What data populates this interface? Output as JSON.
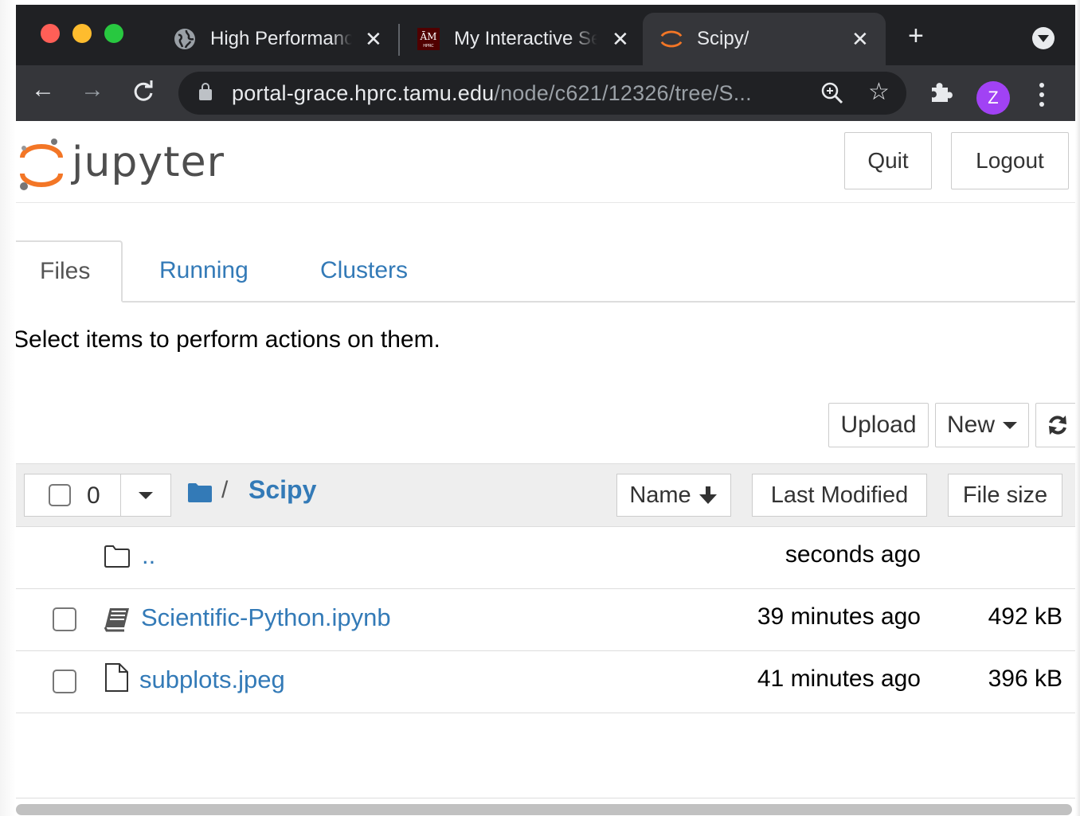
{
  "browser": {
    "tabs": [
      {
        "title": "High Performance Research Computing",
        "icon": "globe-icon"
      },
      {
        "title": "My Interactive Sessions",
        "icon": "tamu-hprc-icon"
      },
      {
        "title": "Scipy/",
        "icon": "jupyter-icon"
      }
    ],
    "active_tab": 2,
    "url_host": "portal-grace.hprc.tamu.edu",
    "url_path": "/node/c621/12326/tree/S...",
    "profile_initial": "Z",
    "colors": {
      "tab_strip": "#202124",
      "toolbar": "#35363a",
      "avatar": "#a142f4"
    }
  },
  "header": {
    "logo_text": "jupyter",
    "quit_label": "Quit",
    "logout_label": "Logout"
  },
  "tabs": [
    {
      "label": "Files",
      "active": true
    },
    {
      "label": "Running",
      "active": false
    },
    {
      "label": "Clusters",
      "active": false
    }
  ],
  "hint": "Select items to perform actions on them.",
  "actions": {
    "upload_label": "Upload",
    "new_label": "New",
    "refresh_icon": "refresh-icon"
  },
  "list_header": {
    "selected_count": "0",
    "breadcrumb_sep": "/",
    "breadcrumb_current": "Scipy",
    "sort_name_label": "Name",
    "sort_modified_label": "Last Modified",
    "sort_size_label": "File size"
  },
  "rows": [
    {
      "name": "..",
      "icon": "folder-icon",
      "modified": "seconds ago",
      "size": ""
    },
    {
      "name": "Scientific-Python.ipynb",
      "icon": "notebook-icon",
      "modified": "39 minutes ago",
      "size": "492 kB"
    },
    {
      "name": "subplots.jpeg",
      "icon": "file-icon",
      "modified": "41 minutes ago",
      "size": "396 kB"
    }
  ],
  "link_color": "#337ab7"
}
